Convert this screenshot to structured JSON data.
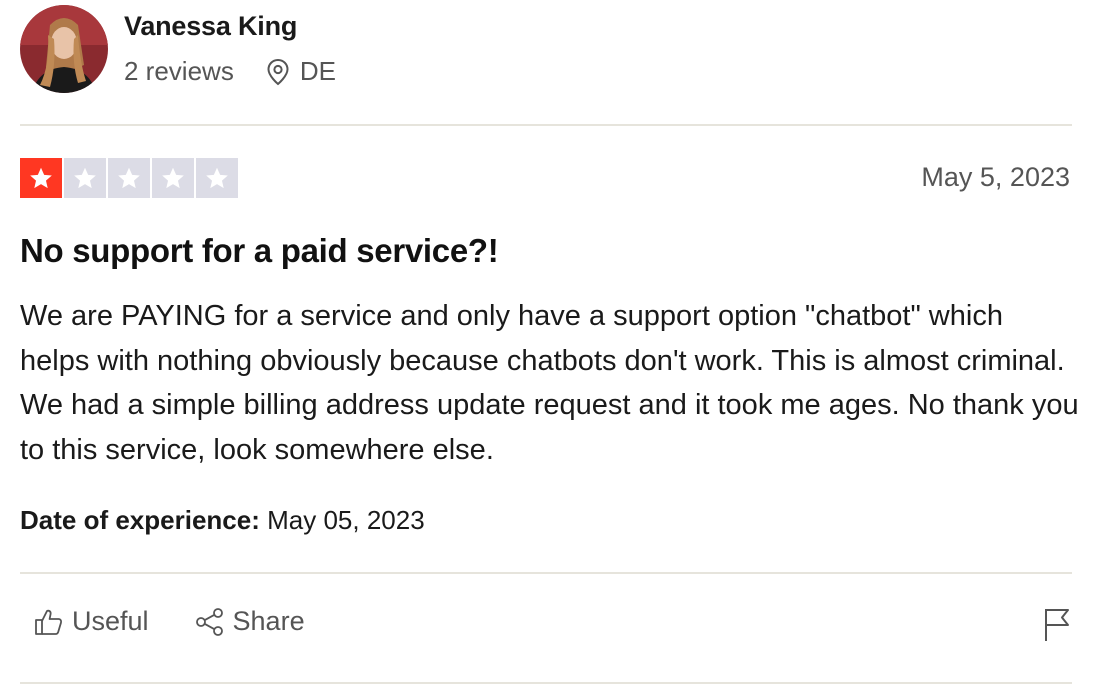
{
  "reviewer": {
    "name": "Vanessa King",
    "reviews_count": "2 reviews",
    "country": "DE"
  },
  "review": {
    "rating": 1,
    "max_rating": 5,
    "date": "May 5, 2023",
    "title": "No support for a paid service?!",
    "body": "We are PAYING for a service and only have a support option \"chatbot\" which helps with nothing obviously because chatbots don't work. This is almost criminal. We had a simple billing address update request and it took me ages. No thank you to this service, look somewhere else.",
    "experience_label": "Date of experience:",
    "experience_date": "May 05, 2023"
  },
  "actions": {
    "useful_label": "Useful",
    "share_label": "Share"
  },
  "colors": {
    "star_on": "#ff3722",
    "star_off": "#dcdce6",
    "divider": "#e6e4dc"
  },
  "icons": {
    "location": "location-pin-icon",
    "useful": "thumbs-up-icon",
    "share": "share-icon",
    "report": "flag-icon"
  }
}
